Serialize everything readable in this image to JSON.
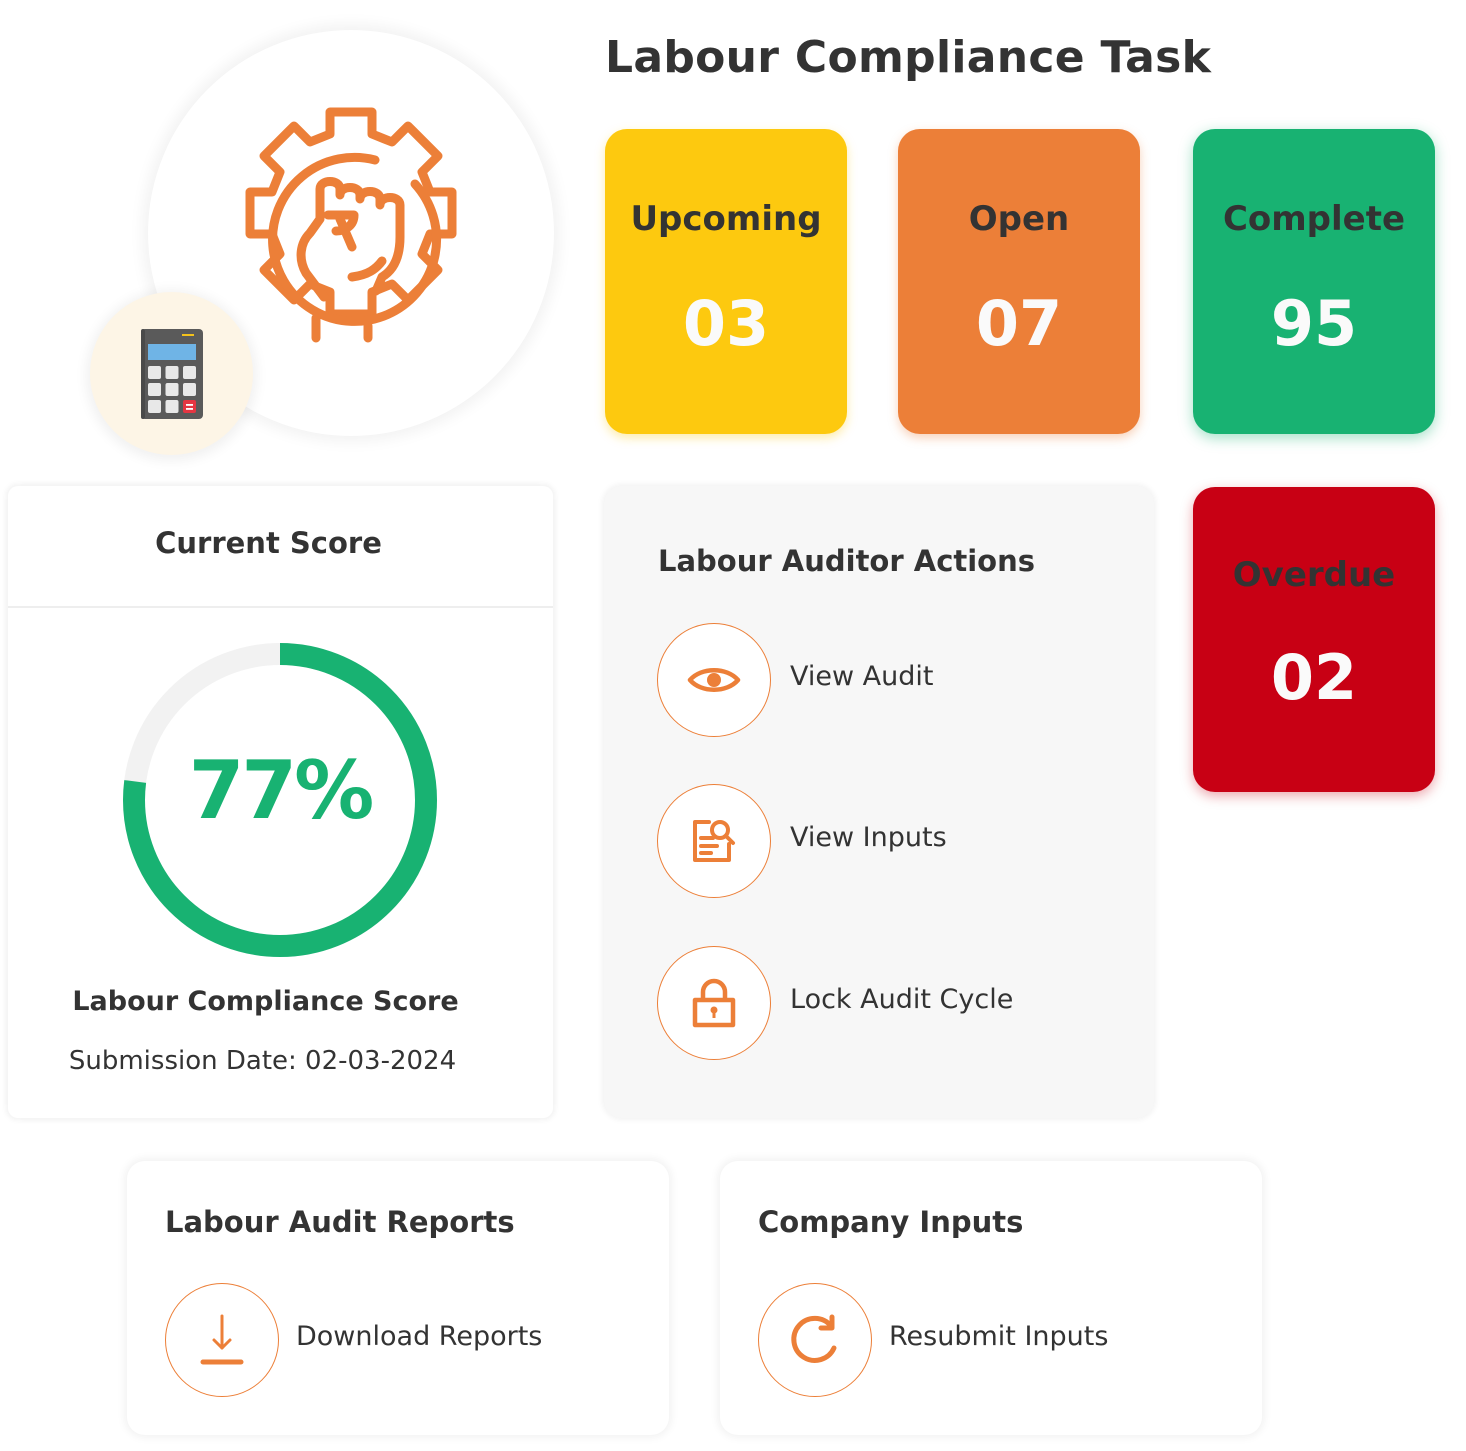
{
  "header": {
    "title": "Labour Compliance Task"
  },
  "hero": {
    "main_icon": "gear-fist-icon",
    "badge_icon": "calculator-icon",
    "accent_color": "#ec7f38",
    "badge_background": "#fdf5e6"
  },
  "status_cards": [
    {
      "label": "Upcoming",
      "value": "03",
      "color": "#fdc90f"
    },
    {
      "label": "Open",
      "value": "07",
      "color": "#ec7f38"
    },
    {
      "label": "Complete",
      "value": "95",
      "color": "#18b272"
    },
    {
      "label": "Overdue",
      "value": "02",
      "color": "#c80014"
    }
  ],
  "score": {
    "title": "Current Score",
    "percent_label": "77%",
    "percent_value": 77,
    "name": "Labour Compliance Score",
    "submission_date": "Submission Date: 02-03-2024",
    "ring_color": "#18b272",
    "track_color": "#f2f2f2"
  },
  "auditor_actions": {
    "title": "Labour Auditor Actions",
    "items": [
      {
        "label": "View Audit",
        "icon": "eye-icon"
      },
      {
        "label": "View Inputs",
        "icon": "document-search-icon"
      },
      {
        "label": "Lock Audit Cycle",
        "icon": "lock-icon"
      }
    ]
  },
  "reports": {
    "title": "Labour Audit Reports",
    "action": {
      "label": "Download Reports",
      "icon": "download-icon"
    }
  },
  "company_inputs": {
    "title": "Company Inputs",
    "action": {
      "label": "Resubmit Inputs",
      "icon": "refresh-icon"
    }
  }
}
